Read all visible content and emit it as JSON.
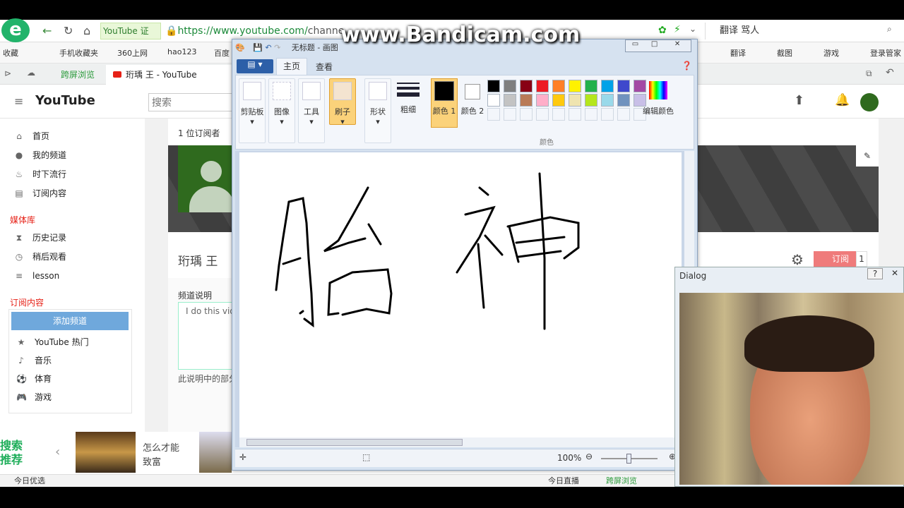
{
  "browser": {
    "logo": "e",
    "site_badge": "YouTube 证",
    "url_host": "https://www.youtube.com/",
    "url_path": "channe",
    "search_query": "翻译 骂人",
    "bookmarks": [
      "收藏",
      "手机收藏夹",
      "360上网",
      "hao123",
      "百度"
    ],
    "toolbar_right": [
      "翻译",
      "截图",
      "游戏",
      "登录管家"
    ],
    "tabs": {
      "cross_screen": "跨屏浏览",
      "active": "珩瑀 王 - YouTube"
    }
  },
  "youtube": {
    "logo": "YouTube",
    "search_placeholder": "搜索",
    "subscribers": "1 位订阅者",
    "channel_name": "珩瑀 王",
    "sidebar": [
      {
        "icon": "home-icon",
        "glyph": "⌂",
        "label": "首页"
      },
      {
        "icon": "my-channel-icon",
        "glyph": "●",
        "label": "我的频道"
      },
      {
        "icon": "trending-icon",
        "glyph": "♨",
        "label": "时下流行"
      },
      {
        "icon": "subscriptions-icon",
        "glyph": "▤",
        "label": "订阅内容"
      }
    ],
    "library_title": "媒体库",
    "library": [
      {
        "icon": "history-icon",
        "glyph": "⧗",
        "label": "历史记录"
      },
      {
        "icon": "watch-later-icon",
        "glyph": "◷",
        "label": "稍后观看"
      },
      {
        "icon": "playlist-icon",
        "glyph": "≡",
        "label": "lesson"
      }
    ],
    "subs_title": "订阅内容",
    "add_channel": "添加频道",
    "subs": [
      {
        "icon": "star-icon",
        "glyph": "★",
        "label": "YouTube 热门"
      },
      {
        "icon": "music-icon",
        "glyph": "♪",
        "label": "音乐"
      },
      {
        "icon": "sports-icon",
        "glyph": "⚽",
        "label": "体育"
      },
      {
        "icon": "gaming-icon",
        "glyph": "🎮",
        "label": "游戏"
      }
    ],
    "desc_label": "频道说明",
    "desc_text": "I do this vide",
    "desc_note": "此说明中的部分",
    "subscribe": "订阅",
    "sub_count": "1"
  },
  "paint": {
    "title": "无标题 - 画图",
    "tabs": [
      "主页",
      "查看"
    ],
    "groups": [
      "剪贴板",
      "图像",
      "工具",
      "刷子",
      "形状",
      "粗细"
    ],
    "color1": "颜色 1",
    "color2": "颜色 2",
    "edit_colors": "编辑颜色",
    "colors_group": "颜色",
    "palette": [
      "#000000",
      "#7f7f7f",
      "#880015",
      "#ed1c24",
      "#ff7f27",
      "#fff200",
      "#22b14c",
      "#00a2e8",
      "#3f48cc",
      "#a349a4",
      "#ffffff",
      "#c3c3c3",
      "#b97a57",
      "#ffaec9",
      "#ffc90e",
      "#efe4b0",
      "#b5e61d",
      "#99d9ea",
      "#7092be",
      "#c8bfe7"
    ],
    "zoom": "100%",
    "accent": "#fbd27a"
  },
  "dialog": {
    "title": "Dialog"
  },
  "ad": {
    "label": "搜索推荐",
    "caption1": "怎么才能",
    "caption2": "致富"
  },
  "status": {
    "left": "今日优选",
    "live": "今日直播",
    "cross": "跨屏浏览"
  },
  "watermark": "www.Bandicam.com"
}
